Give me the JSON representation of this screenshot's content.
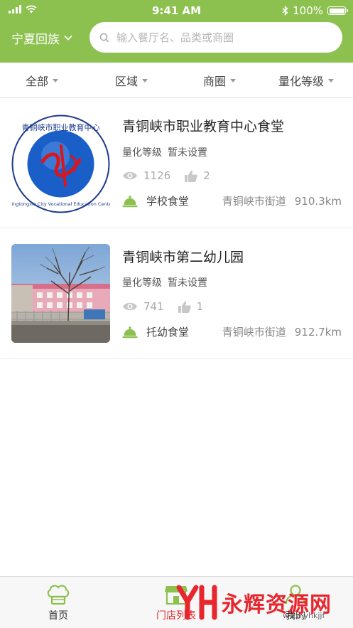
{
  "status_bar": {
    "time": "9:41 AM",
    "battery": "100%"
  },
  "header": {
    "city": "宁夏回族",
    "search_placeholder": "输入餐厅名、品类或商圈"
  },
  "filters": [
    "全部",
    "区域",
    "商圈",
    "量化等级"
  ],
  "restaurants": [
    {
      "name": "青铜峡市职业教育中心食堂",
      "level_label": "量化等级",
      "level_value": "暂未设置",
      "views": "1126",
      "likes": "2",
      "type": "学校食堂",
      "street": "青铜峡市街道",
      "distance": "910.3km",
      "logo_text": "青铜峡市职业教育中心",
      "logo_subtext": "Qingtongxia City Vocational Education Center"
    },
    {
      "name": "青铜峡市第二幼儿园",
      "level_label": "量化等级",
      "level_value": "暂未设置",
      "views": "741",
      "likes": "1",
      "type": "托幼食堂",
      "street": "青铜峡市街道",
      "distance": "912.7km"
    }
  ],
  "tabbar": {
    "tabs": [
      {
        "label": "首页",
        "icon": "chef-hat-icon",
        "active": false
      },
      {
        "label": "门店列表",
        "icon": "store-icon",
        "active": true
      },
      {
        "label": "我的",
        "icon": "user-icon",
        "active": false
      }
    ]
  },
  "watermark": {
    "text": "永辉资源网",
    "url": "www.yhkjjf"
  },
  "colors": {
    "brand": "#8cc150",
    "active_tab": "#e8262e",
    "icon_green": "#8cc150"
  }
}
